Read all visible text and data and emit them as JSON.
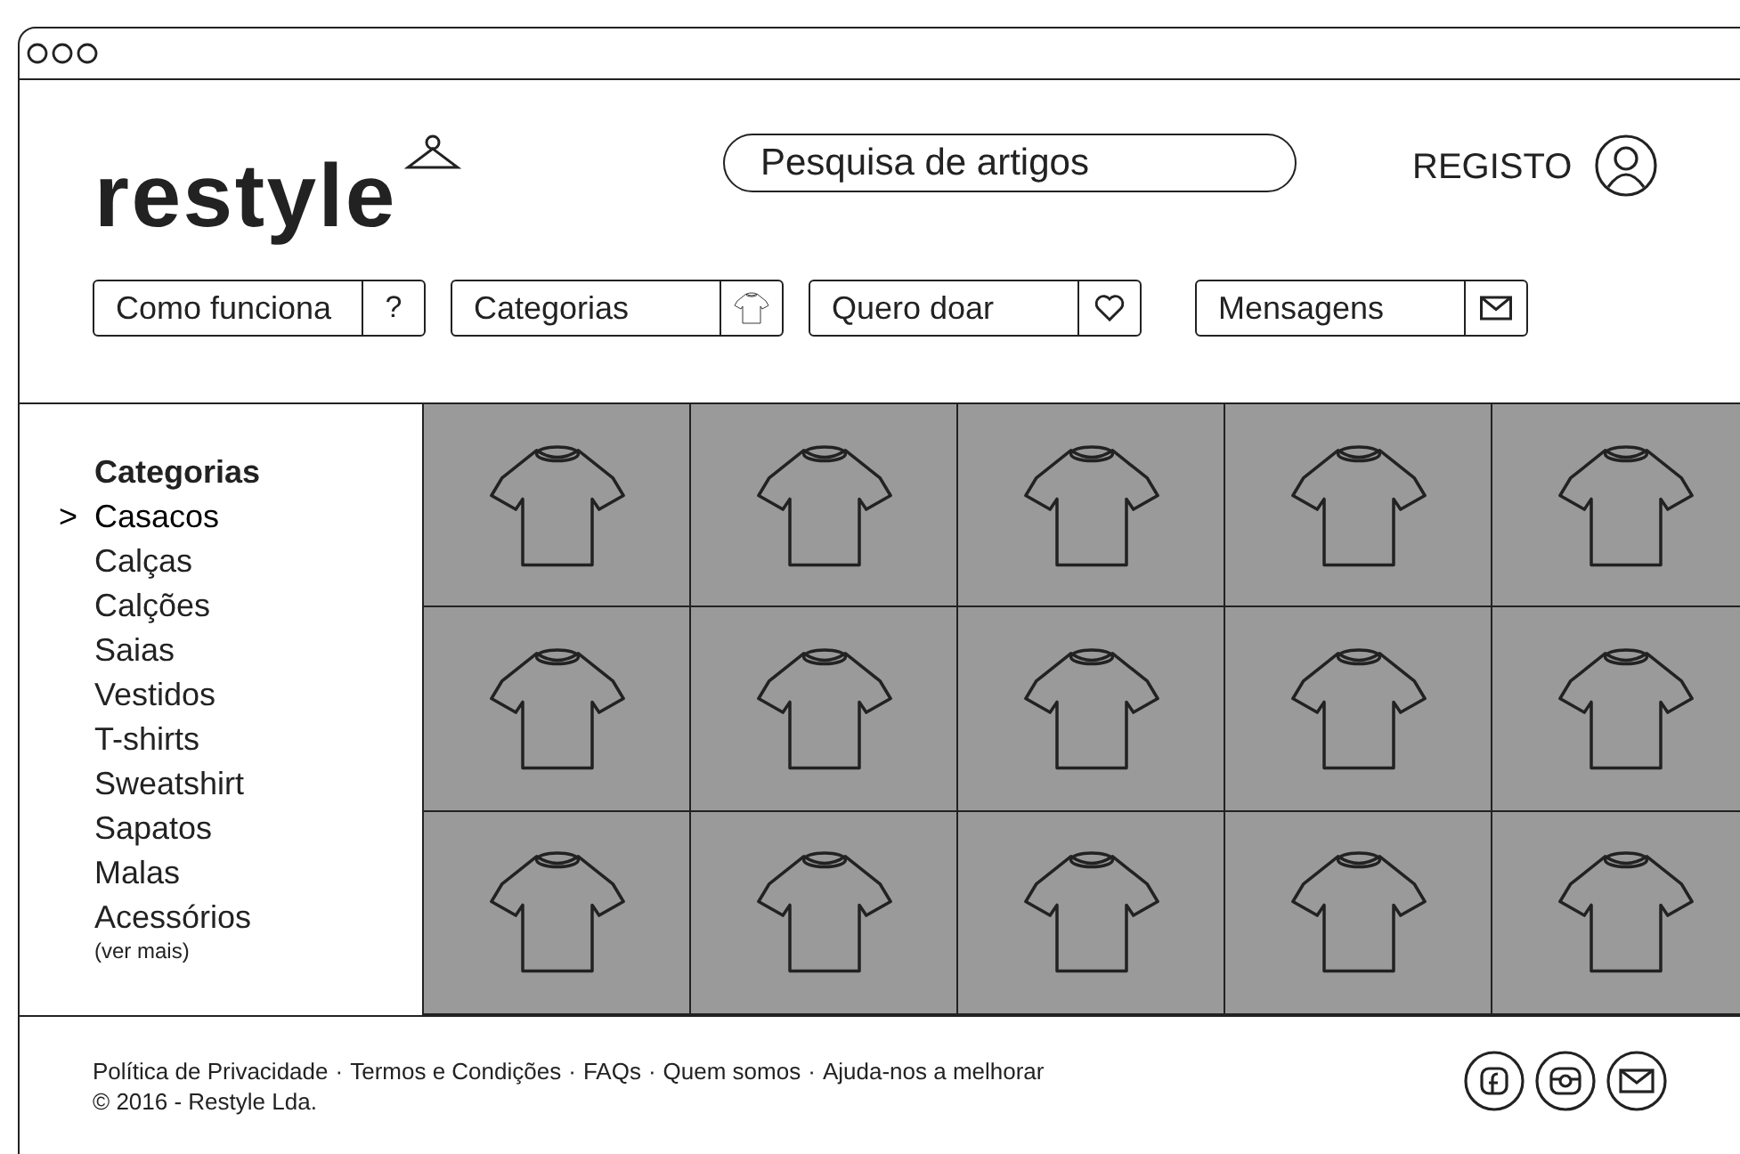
{
  "logo": {
    "text": "restyle"
  },
  "search": {
    "placeholder": "Pesquisa de artigos"
  },
  "account": {
    "label": "REGISTO"
  },
  "nav": [
    {
      "label": "Como funciona",
      "kind": "char",
      "char": "?"
    },
    {
      "label": "Categorias",
      "kind": "tshirt"
    },
    {
      "label": "Quero doar",
      "kind": "heart"
    },
    {
      "label": "Mensagens",
      "kind": "mail"
    }
  ],
  "sidebar": {
    "title": "Categorias",
    "marker": ">",
    "more": "(ver mais)",
    "items": [
      {
        "label": "Casacos",
        "selected": true
      },
      {
        "label": "Calças",
        "selected": false
      },
      {
        "label": "Calções",
        "selected": false
      },
      {
        "label": "Saias",
        "selected": false
      },
      {
        "label": "Vestidos",
        "selected": false
      },
      {
        "label": "T-shirts",
        "selected": false
      },
      {
        "label": "Sweatshirt",
        "selected": false
      },
      {
        "label": "Sapatos",
        "selected": false
      },
      {
        "label": "Malas",
        "selected": false
      },
      {
        "label": "Acessórios",
        "selected": false
      }
    ]
  },
  "tiles": [
    {
      "kind": "tshirt"
    },
    {
      "kind": "tshirt"
    },
    {
      "kind": "tshirt"
    },
    {
      "kind": "tshirt"
    },
    {
      "kind": "tshirt"
    },
    {
      "kind": "tshirt"
    },
    {
      "kind": "tshirt"
    },
    {
      "kind": "tshirt"
    },
    {
      "kind": "tshirt"
    },
    {
      "kind": "tshirt"
    },
    {
      "kind": "tshirt"
    },
    {
      "kind": "tshirt"
    },
    {
      "kind": "tshirt"
    },
    {
      "kind": "tshirt"
    },
    {
      "kind": "tshirt"
    }
  ],
  "footer": {
    "separator": "·",
    "links": [
      "Política de Privacidade",
      "Termos e Condições",
      "FAQs",
      "Quem somos",
      "Ajuda-nos a melhorar"
    ],
    "copyright": "© 2016 - Restyle Lda.",
    "social": [
      {
        "kind": "facebook"
      },
      {
        "kind": "camera"
      },
      {
        "kind": "mail"
      }
    ]
  }
}
